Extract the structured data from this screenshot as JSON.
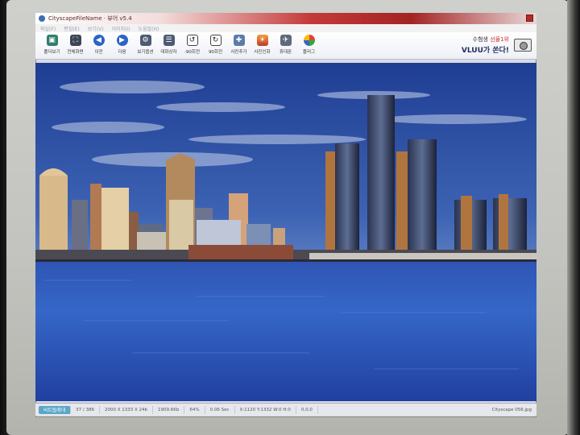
{
  "window": {
    "title": "CityscapeFileName · 뷰어 v5.4"
  },
  "menu": [
    {
      "label": "파일(F)"
    },
    {
      "label": "편집(E)"
    },
    {
      "label": "보기(V)"
    },
    {
      "label": "이미지(I)"
    },
    {
      "label": "도움말(H)"
    }
  ],
  "toolbar": {
    "items": [
      {
        "label": "폴더보기",
        "icon": "folder-view-icon",
        "glyph": "▣",
        "style": "teal"
      },
      {
        "label": "전체화면",
        "icon": "fullscreen-icon",
        "glyph": "⛶",
        "style": "dark"
      },
      {
        "label": "이전",
        "icon": "previous-icon",
        "glyph": "◀",
        "style": "blue"
      },
      {
        "label": "다음",
        "icon": "next-icon",
        "glyph": "▶",
        "style": "blue"
      },
      {
        "label": "보기옵션",
        "icon": "view-options-icon",
        "glyph": "⚙",
        "style": "slate"
      },
      {
        "label": "대화상자",
        "icon": "dialog-icon",
        "glyph": "☰",
        "style": "slate"
      },
      {
        "label": "-90회전",
        "icon": "rotate-left-icon",
        "glyph": "↺",
        "style": "box"
      },
      {
        "label": "90회전",
        "icon": "rotate-right-icon",
        "glyph": "↻",
        "style": "box"
      },
      {
        "label": "사진추가",
        "icon": "add-photo-icon",
        "glyph": "✚",
        "style": "photo"
      },
      {
        "label": "사진인화",
        "icon": "print-photo-icon",
        "glyph": "☀",
        "style": "sunset"
      },
      {
        "label": "휴대폰",
        "icon": "phone-icon",
        "glyph": "✈",
        "style": "plane"
      },
      {
        "label": "플러그",
        "icon": "plugin-icon",
        "glyph": "",
        "style": "multi"
      }
    ]
  },
  "brand": {
    "line1_prefix": "수험생 ",
    "line1_accent": "선물1위",
    "line2": "VLUU가 쏜다!"
  },
  "status": {
    "item1": "비트맵/확대",
    "item2": "37 / 386",
    "item3": "2000 X 1333 X 24b",
    "item4": "1909.6Kb",
    "item5": "64%",
    "item6": "0.06 Sec",
    "item7": "X:1120 Y:1332 W:0 H:0",
    "item8": "0,0,0",
    "file": "Cityscape 056.jpg"
  }
}
